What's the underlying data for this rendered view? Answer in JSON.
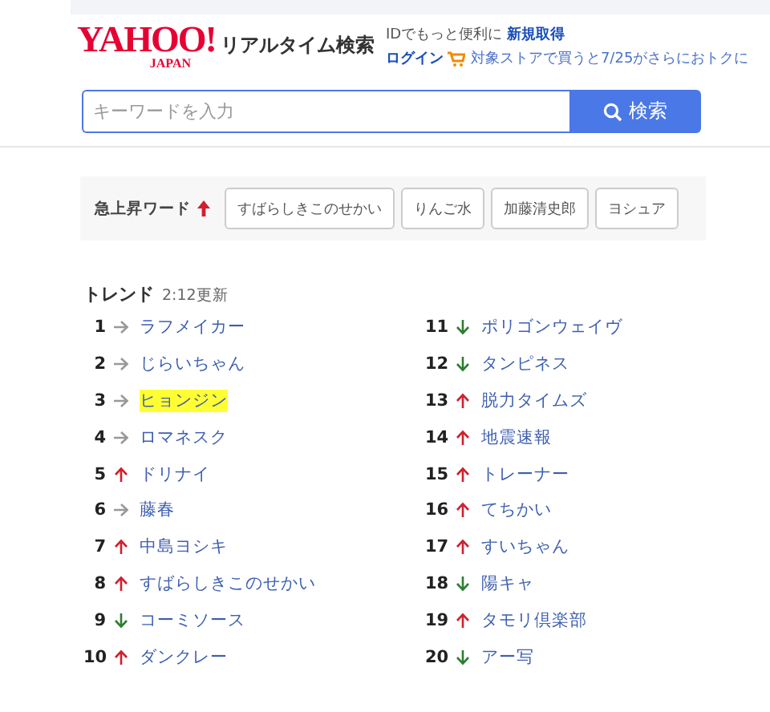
{
  "header": {
    "logo": "YAHOO!",
    "logo_sub": "JAPAN",
    "service": "リアルタイム検索",
    "id_prompt": "IDでもっと便利に",
    "signup_link": "新規取得",
    "login_link": "ログイン",
    "promo": "対象ストアで買うと7/25がさらにおトクに"
  },
  "search": {
    "placeholder": "キーワードを入力",
    "button": "検索"
  },
  "rising": {
    "label": "急上昇ワード",
    "words": [
      "すばらしきこのせかい",
      "りんご水",
      "加藤清史郎",
      "ヨシュア"
    ]
  },
  "trends": {
    "title": "トレンド",
    "updated": "2:12更新",
    "items": [
      {
        "rank": "1",
        "kind": "flat",
        "word": "ラフメイカー",
        "highlighted": false
      },
      {
        "rank": "2",
        "kind": "flat",
        "word": "じらいちゃん",
        "highlighted": false
      },
      {
        "rank": "3",
        "kind": "flat",
        "word": "ヒョンジン",
        "highlighted": true
      },
      {
        "rank": "4",
        "kind": "flat",
        "word": "ロマネスク",
        "highlighted": false
      },
      {
        "rank": "5",
        "kind": "up",
        "word": "ドリナイ",
        "highlighted": false
      },
      {
        "rank": "6",
        "kind": "flat",
        "word": "藤春",
        "highlighted": false
      },
      {
        "rank": "7",
        "kind": "up",
        "word": "中島ヨシキ",
        "highlighted": false
      },
      {
        "rank": "8",
        "kind": "up",
        "word": "すばらしきこのせかい",
        "highlighted": false
      },
      {
        "rank": "9",
        "kind": "down",
        "word": "コーミソース",
        "highlighted": false
      },
      {
        "rank": "10",
        "kind": "up",
        "word": "ダンクレー",
        "highlighted": false
      },
      {
        "rank": "11",
        "kind": "down",
        "word": "ポリゴンウェイヴ",
        "highlighted": false
      },
      {
        "rank": "12",
        "kind": "down",
        "word": "タンピネス",
        "highlighted": false
      },
      {
        "rank": "13",
        "kind": "up",
        "word": "脱力タイムズ",
        "highlighted": false
      },
      {
        "rank": "14",
        "kind": "up",
        "word": "地震速報",
        "highlighted": false
      },
      {
        "rank": "15",
        "kind": "up",
        "word": "トレーナー",
        "highlighted": false
      },
      {
        "rank": "16",
        "kind": "up",
        "word": "てちかい",
        "highlighted": false
      },
      {
        "rank": "17",
        "kind": "up",
        "word": "すいちゃん",
        "highlighted": false
      },
      {
        "rank": "18",
        "kind": "down",
        "word": "陽キャ",
        "highlighted": false
      },
      {
        "rank": "19",
        "kind": "up",
        "word": "タモリ倶楽部",
        "highlighted": false
      },
      {
        "rank": "20",
        "kind": "down",
        "word": "アー写",
        "highlighted": false
      }
    ]
  }
}
